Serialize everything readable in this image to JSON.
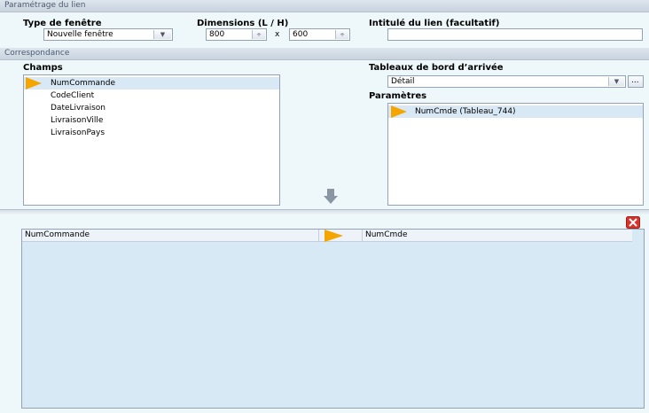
{
  "link_settings": {
    "header": "Paramétrage du lien",
    "window_type_label": "Type de fenêtre",
    "window_type_value": "Nouvelle fenêtre",
    "dimensions_label": "Dimensions (L / H)",
    "width_value": "800",
    "times_symbol": "x",
    "height_value": "600",
    "link_title_label": "Intitulé du lien (facultatif)",
    "link_title_value": ""
  },
  "mapping": {
    "header": "Correspondance",
    "fields_label": "Champs",
    "fields": [
      "NumCommande",
      "CodeClient",
      "DateLivraison",
      "LivraisonVille",
      "LivraisonPays"
    ],
    "selected_field_index": 0,
    "target_dashboard_label": "Tableaux de bord d’arrivée",
    "target_dashboard_value": "Détail",
    "browse_label": "...",
    "parameters_label": "Paramètres",
    "parameters": [
      "NumCmde (Tableau_744)"
    ]
  },
  "mapping_table": {
    "rows": [
      {
        "source": "NumCommande",
        "target": "NumCmde"
      }
    ]
  },
  "colors": {
    "accent_arrow": "#f5a500",
    "delete": "#d9342b"
  }
}
